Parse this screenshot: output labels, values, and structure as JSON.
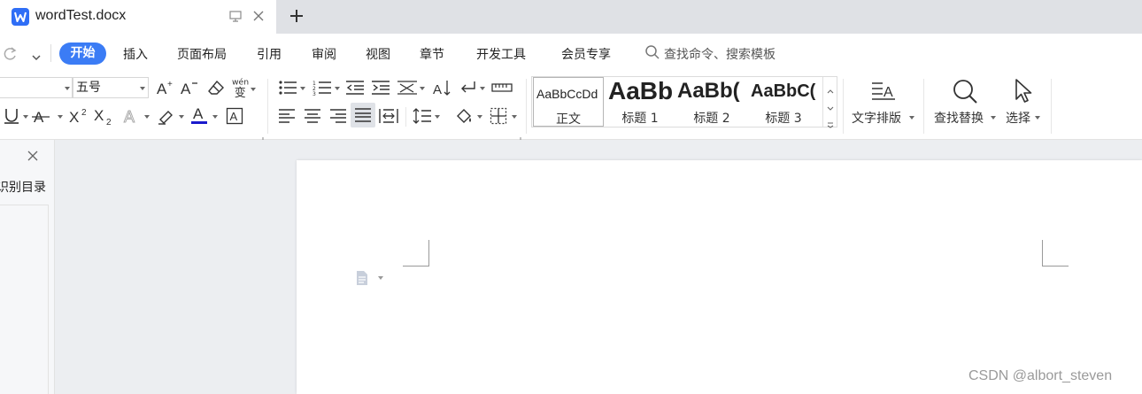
{
  "tab": {
    "title": "wordTest.docx"
  },
  "menu": {
    "items": [
      "开始",
      "插入",
      "页面布局",
      "引用",
      "审阅",
      "视图",
      "章节",
      "开发工具",
      "会员专享"
    ],
    "active_index": 0,
    "search_placeholder": "查找命令、搜索模板"
  },
  "ribbon": {
    "font_name": "",
    "font_size": "五号",
    "styles": [
      {
        "sample": "AaBbCcDd",
        "name": "正文"
      },
      {
        "sample": "AaBb",
        "name": "标题 1"
      },
      {
        "sample": "AaBb(",
        "name": "标题 2"
      },
      {
        "sample": "AaBbC(",
        "name": "标题 3"
      }
    ],
    "text_layout_label": "文字排版",
    "find_replace_label": "查找替换",
    "select_label": "选择",
    "pinyin_label": "wén"
  },
  "nav": {
    "title": "识别目录"
  },
  "watermark": "CSDN @albort_steven",
  "colors": {
    "accent": "#3b7cf5",
    "font_color_bar": "#1a1acc"
  }
}
